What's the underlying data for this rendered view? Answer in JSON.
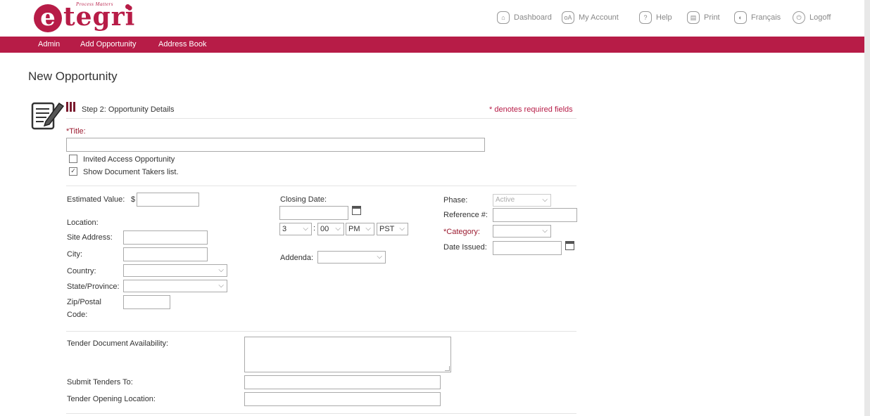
{
  "brand": {
    "logo_letter": "e",
    "logo_word": "tegri",
    "tagline": "Process Matters"
  },
  "toolbar": {
    "dashboard": "Dashboard",
    "my_account": "My Account",
    "help": "Help",
    "print": "Print",
    "francais": "Français",
    "logoff": "Logoff"
  },
  "menu": {
    "admin": "Admin",
    "add_opportunity": "Add Opportunity",
    "address_book": "Address Book"
  },
  "page": {
    "title": "New Opportunity"
  },
  "step": {
    "title": "Step 2: Opportunity Details",
    "required_note": "* denotes required fields"
  },
  "form": {
    "title_label": "*Title:",
    "invited_access": {
      "label": "Invited Access Opportunity",
      "checked": false
    },
    "show_doc_takers": {
      "label": "Show Document Takers list.",
      "checked": true
    },
    "estimated_value_label": "Estimated Value:",
    "currency_symbol": "$",
    "location_label": "Location:",
    "site_address_label": "Site Address:",
    "city_label": "City:",
    "country_label": "Country:",
    "state_label": "State/Province:",
    "zip_label_1": "Zip/Postal",
    "zip_label_2": "Code:",
    "closing_date_label": "Closing Date:",
    "closing_hour": "3",
    "closing_minute": "00",
    "closing_ampm": "PM",
    "closing_tz": "PST",
    "time_separator": ":",
    "addenda_label": "Addenda:",
    "phase_label": "Phase:",
    "phase_value": "Active",
    "reference_label": "Reference #:",
    "category_label": "*Category:",
    "date_issued_label": "Date Issued:",
    "tender_doc_label": "Tender Document Availability:",
    "submit_to_label": "Submit Tenders To:",
    "opening_location_label": "Tender Opening Location:"
  }
}
